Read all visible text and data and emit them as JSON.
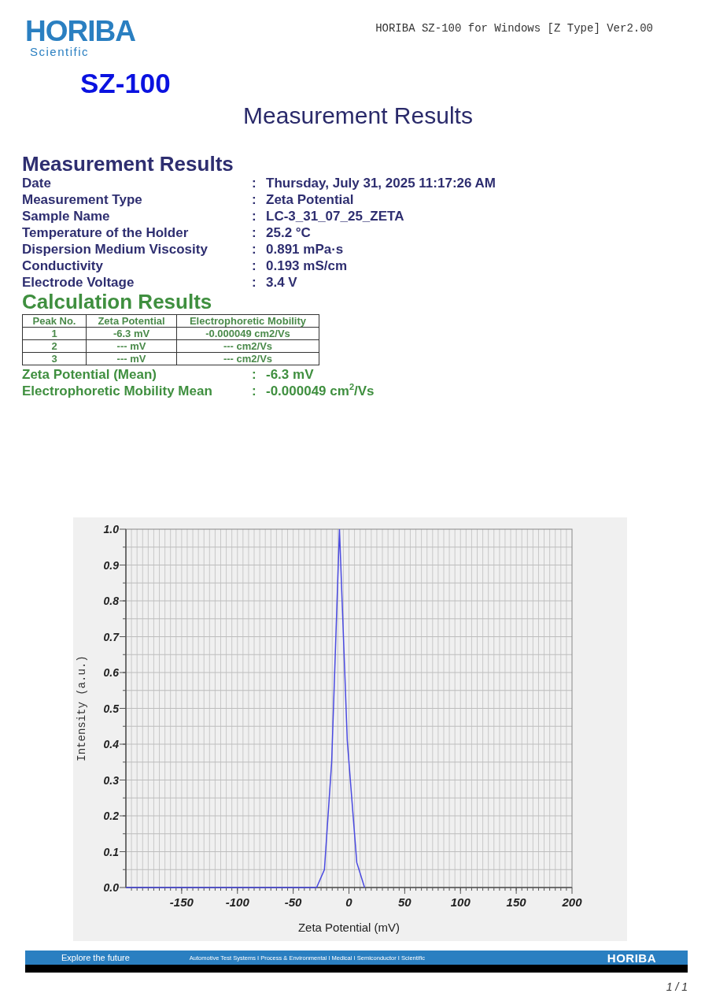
{
  "header": {
    "logo": "HORIBA",
    "logo_sub": "Scientific",
    "model": "SZ-100",
    "software": "HORIBA SZ-100 for Windows [Z Type] Ver2.00"
  },
  "title": "Measurement Results",
  "measurement": {
    "heading": "Measurement Results",
    "rows": [
      {
        "label": "Date",
        "sep": ":",
        "value": "Thursday, July 31, 2025 11:17:26 AM"
      },
      {
        "label": "Measurement Type",
        "sep": ":",
        "value": "Zeta Potential"
      },
      {
        "label": "Sample Name",
        "sep": ":",
        "value": "LC-3_31_07_25_ZETA"
      },
      {
        "label": "Temperature of the Holder",
        "sep": ":",
        "value": "25.2 °C"
      },
      {
        "label": "Dispersion Medium Viscosity",
        "sep": ":",
        "value": "0.891 mPa·s"
      },
      {
        "label": "Conductivity",
        "sep": ":",
        "value": "0.193 mS/cm"
      },
      {
        "label": "Electrode Voltage",
        "sep": ":",
        "value": "3.4 V"
      }
    ]
  },
  "calculation": {
    "heading": "Calculation Results",
    "table": {
      "columns": [
        "Peak No.",
        "Zeta Potential",
        "Electrophoretic Mobility"
      ],
      "rows": [
        [
          "1",
          "-6.3 mV",
          "-0.000049 cm2/Vs"
        ],
        [
          "2",
          "--- mV",
          "--- cm2/Vs"
        ],
        [
          "3",
          "--- mV",
          "--- cm2/Vs"
        ]
      ]
    },
    "summary": [
      {
        "label": "Zeta Potential (Mean)",
        "sep": ":",
        "value": "-6.3 mV"
      },
      {
        "label": "Electrophoretic Mobility Mean",
        "sep": ":",
        "value": "-0.000049 cm$^{2}$/Vs"
      }
    ]
  },
  "chart": {
    "chart_data": {
      "type": "line",
      "xlabel": "Zeta Potential (mV)",
      "ylabel": "Intensity (a.u.)",
      "x": [
        -200,
        -29,
        -22,
        -15.5,
        -8.5,
        -1.5,
        7,
        14
      ],
      "grid": true,
      "series": [
        {
          "color": "#4a4ae0",
          "values": [
            0,
            0,
            0.05,
            0.35,
            1.0,
            0.41,
            0.07,
            0
          ]
        }
      ],
      "xlim": [
        -200,
        200
      ],
      "ylim": [
        0,
        1
      ],
      "xticks": [
        -150,
        -100,
        -50,
        0,
        50,
        100,
        150,
        200
      ],
      "yticks": [
        {
          "value": 0,
          "label": "0.0"
        },
        {
          "value": 0.1,
          "label": "0.1"
        },
        {
          "value": 0.2,
          "label": "0.2"
        },
        {
          "value": 0.3,
          "label": "0.3"
        },
        {
          "value": 0.4,
          "label": "0.4"
        },
        {
          "value": 0.5,
          "label": "0.5"
        },
        {
          "value": 0.6,
          "label": "0.6"
        },
        {
          "value": 0.7,
          "label": "0.7"
        },
        {
          "value": 0.8,
          "label": "0.8"
        },
        {
          "value": 0.9,
          "label": "0.9"
        },
        {
          "value": 1,
          "label": "1.0"
        }
      ]
    }
  },
  "footer": {
    "slogan": "Explore the future",
    "divisions": "Automotive Test Systems  I  Process & Environmental  I  Medical  I  Semiconductor  I  Scientific",
    "logo": "HORIBA"
  },
  "page": "1 / 1"
}
